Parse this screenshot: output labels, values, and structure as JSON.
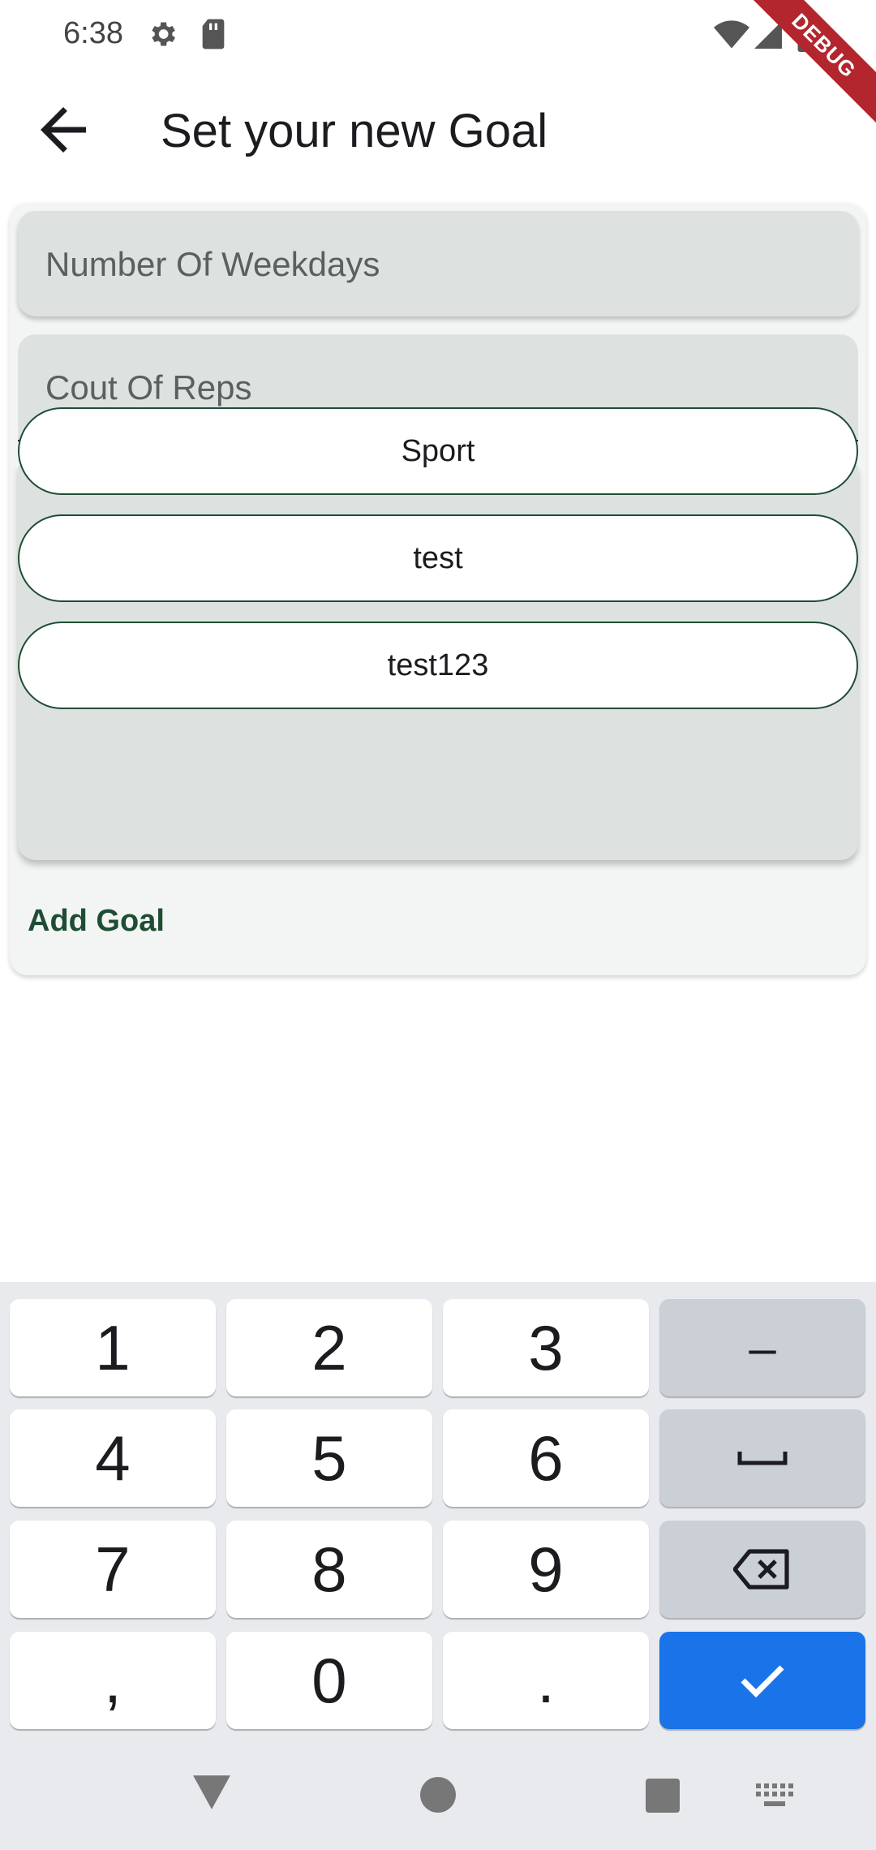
{
  "status_bar": {
    "time": "6:38",
    "debug_label": "DEBUG",
    "icons": [
      "gear-icon",
      "sd-card-icon",
      "wifi-icon",
      "signal-icon",
      "battery-icon"
    ]
  },
  "app_bar": {
    "title": "Set your new Goal",
    "back_icon": "arrow-back-icon"
  },
  "form": {
    "weekdays_placeholder": "Number Of Weekdays",
    "reps_placeholder": "Cout Of Reps",
    "categories": [
      "Sport",
      "test",
      "test123"
    ],
    "add_goal_label": "Add Goal"
  },
  "keyboard": {
    "keys": [
      "1",
      "2",
      "3",
      "–",
      "4",
      "5",
      "6",
      "␣",
      "7",
      "8",
      "9",
      "backspace",
      ",",
      "0",
      ".",
      "done"
    ]
  },
  "colors": {
    "accent": "#1e4d33",
    "keyboard_action": "#1a73e8",
    "debug_ribbon": "#b3262d"
  }
}
